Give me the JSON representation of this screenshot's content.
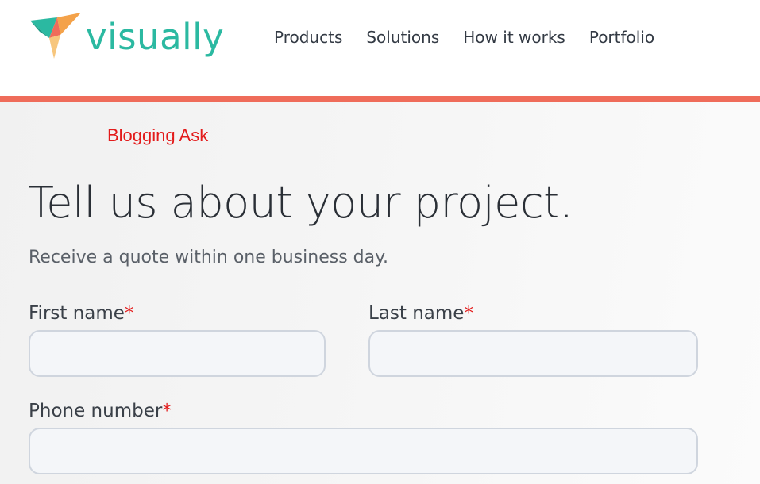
{
  "brand": {
    "name": "visually",
    "logo_icon": "folded-triangle-logo-icon"
  },
  "nav": {
    "items": [
      "Products",
      "Solutions",
      "How it works",
      "Portfolio"
    ]
  },
  "colors": {
    "brand_teal": "#2bb9a1",
    "accent_bar": "#ef6c5a",
    "required_asterisk": "#e31b1b",
    "label_red": "#e31b1b"
  },
  "annotation": {
    "text": "Blogging Ask"
  },
  "form": {
    "title": "Tell us about your project.",
    "subtitle": "Receive a quote within one business day.",
    "required_marker": "*",
    "fields": {
      "first_name": {
        "label": "First name",
        "value": "",
        "placeholder": ""
      },
      "last_name": {
        "label": "Last name",
        "value": "",
        "placeholder": ""
      },
      "phone": {
        "label": "Phone number",
        "value": "",
        "placeholder": ""
      }
    }
  }
}
